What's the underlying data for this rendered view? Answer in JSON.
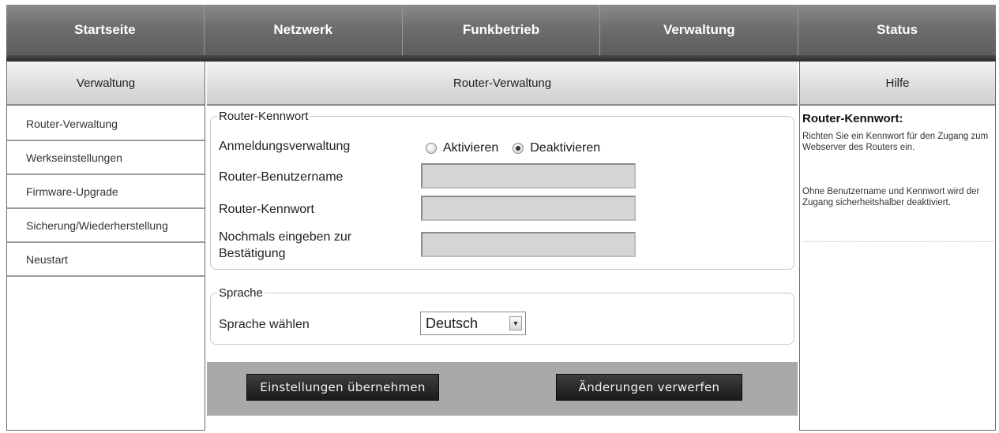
{
  "topnav": [
    {
      "label": "Startseite"
    },
    {
      "label": "Netzwerk"
    },
    {
      "label": "Funkbetrieb"
    },
    {
      "label": "Verwaltung"
    },
    {
      "label": "Status"
    }
  ],
  "sidebar": {
    "header": "Verwaltung",
    "items": [
      {
        "label": "Router-Verwaltung"
      },
      {
        "label": "Werkseinstellungen"
      },
      {
        "label": "Firmware-Upgrade"
      },
      {
        "label": "Sicherung/Wiederherstellung"
      },
      {
        "label": "Neustart"
      }
    ]
  },
  "main": {
    "header": "Router-Verwaltung",
    "password_section": {
      "legend": "Router-Kennwort",
      "login_management_label": "Anmeldungsverwaltung",
      "radio_enable_label": "Aktivieren",
      "radio_disable_label": "Deaktivieren",
      "selected": "Deaktivieren",
      "username_label": "Router-Benutzername",
      "username_value": "",
      "password_label": "Router-Kennwort",
      "password_value": "",
      "confirm_label_line1": "Nochmals eingeben zur",
      "confirm_label_line2": "Bestätigung",
      "confirm_value": ""
    },
    "language_section": {
      "legend": "Sprache",
      "select_label": "Sprache wählen",
      "selected_language": "Deutsch"
    },
    "buttons": {
      "apply": "Einstellungen übernehmen",
      "discard": "Änderungen verwerfen"
    }
  },
  "help": {
    "header": "Hilfe",
    "title": "Router-Kennwort:",
    "paragraph1": "Richten Sie ein Kennwort für den Zugang zum Webserver des Routers ein.",
    "paragraph2": "Ohne Benutzername und Kennwort wird der Zugang sicherheitshalber deaktiviert."
  },
  "icons": {
    "select_arrow": "chevron-down-icon"
  }
}
